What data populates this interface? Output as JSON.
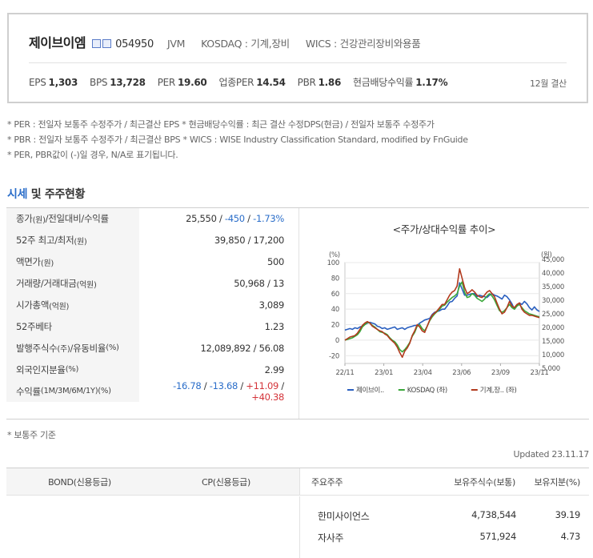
{
  "header": {
    "company_name": "제이브이엠",
    "code": "054950",
    "english_name": "JVM",
    "market": "KOSDAQ : 기계,장비",
    "wics": "WICS : 건강관리장비와용품",
    "ratios": [
      {
        "label": "EPS",
        "value": "1,303"
      },
      {
        "label": "BPS",
        "value": "13,728"
      },
      {
        "label": "PER",
        "value": "19.60"
      },
      {
        "label": "업종PER",
        "value": "14.54"
      },
      {
        "label": "PBR",
        "value": "1.86"
      },
      {
        "label": "현금배당수익률",
        "value": "1.17%"
      }
    ],
    "settlement": "12월 결산"
  },
  "notes": [
    "* PER : 전일자 보통주 수정주가 / 최근결산 EPS * 현금배당수익률 : 최근 결산 수정DPS(현금) / 전일자 보통주 수정주가",
    "* PBR : 전일자 보통주 수정주가 / 최근결산 BPS * WICS : WISE Industry Classification Standard, modified by FnGuide",
    "* PER, PBR값이 (-)일 경우, N/A로 표기됩니다."
  ],
  "section": {
    "title_accent": "시세",
    "title_rest": " 및 주주현황"
  },
  "price_table": {
    "rows": [
      {
        "label": "종가",
        "unit": "(원)",
        "label2": "/전일대비/수익률",
        "v1": "25,550",
        "sep1": " / ",
        "v2": "-450",
        "sep2": " / ",
        "v3": "-1.73%"
      },
      {
        "label": "52주 최고/최저",
        "unit": "(원)",
        "value": "39,850 / 17,200"
      },
      {
        "label": "액면가",
        "unit": "(원)",
        "value": "500"
      },
      {
        "label": "거래량/거래대금",
        "unit": "(억원)",
        "value": "50,968 / 13"
      },
      {
        "label": "시가총액",
        "unit": "(억원)",
        "value": "3,089"
      },
      {
        "label": "52주베타",
        "unit": "",
        "value": "1.23"
      },
      {
        "label": "발행주식수",
        "unit": "(주)",
        "label2": "/유동비율",
        "unit2": "(%)",
        "value": "12,089,892 / 56.08"
      },
      {
        "label": "외국인지분율",
        "unit": "(%)",
        "value": "2.99"
      },
      {
        "label": "수익률",
        "unit": "(1M/3M/6M/1Y)(%)",
        "r1": "-16.78",
        "r2": "-13.68",
        "r3": "+11.09",
        "r4": "+40.38",
        "sep": " / "
      }
    ]
  },
  "chart_data": {
    "type": "line",
    "title": "<주가/상대수익률 추이>",
    "ylabel_left": "(%)",
    "ylabel_right": "(원)",
    "x_ticks": [
      "22/11",
      "23/01",
      "23/04",
      "23/06",
      "23/09",
      "23/11"
    ],
    "y_left_ticks": [
      100,
      80,
      60,
      40,
      20,
      0,
      -20
    ],
    "y_right_ticks": [
      "45,000",
      "40,000",
      "35,000",
      "30,000",
      "25,000",
      "20,000",
      "15,000",
      "10,000",
      "5,000"
    ],
    "ylim_left": [
      -30,
      100
    ],
    "ylim_right": [
      5000,
      45000
    ],
    "grid": true,
    "legend_position": "bottom",
    "series": [
      {
        "name": "제이브이..",
        "color": "#2a5fbf",
        "axis": "left",
        "values": [
          13,
          14,
          15,
          14,
          16,
          15,
          17,
          18,
          20,
          22,
          23,
          22,
          21,
          18,
          17,
          15,
          16,
          14,
          15,
          16,
          17,
          14,
          15,
          16,
          14,
          16,
          17,
          18,
          19,
          19,
          22,
          24,
          26,
          27,
          28,
          33,
          36,
          37,
          38,
          40,
          40,
          44,
          49,
          50,
          54,
          57,
          74,
          66,
          58,
          58,
          59,
          60,
          60,
          56,
          58,
          57,
          56,
          55,
          58,
          60,
          58,
          57,
          55,
          53,
          58,
          56,
          52,
          47,
          40,
          44,
          48,
          46,
          50,
          47,
          42,
          39,
          43,
          39,
          37
        ]
      },
      {
        "name": "KOSDAQ (좌)",
        "color": "#3aa83a",
        "axis": "left",
        "values": [
          0,
          1,
          2,
          3,
          5,
          7,
          11,
          17,
          20,
          23,
          22,
          19,
          17,
          14,
          11,
          10,
          9,
          7,
          3,
          0,
          -2,
          -6,
          -12,
          -15,
          -12,
          -8,
          -3,
          5,
          10,
          18,
          20,
          15,
          12,
          18,
          25,
          30,
          34,
          37,
          40,
          44,
          45,
          49,
          52,
          55,
          57,
          60,
          70,
          75,
          62,
          55,
          56,
          60,
          58,
          54,
          52,
          50,
          53,
          57,
          60,
          57,
          52,
          45,
          38,
          36,
          38,
          42,
          46,
          42,
          40,
          44,
          46,
          42,
          38,
          36,
          34,
          33,
          32,
          31,
          30
        ]
      },
      {
        "name": "기계,장.. (좌)",
        "color": "#b23a1e",
        "axis": "left",
        "values": [
          0,
          2,
          4,
          5,
          6,
          9,
          14,
          19,
          22,
          24,
          22,
          18,
          16,
          14,
          12,
          11,
          8,
          6,
          2,
          -1,
          -4,
          -9,
          -16,
          -22,
          -14,
          -10,
          -4,
          6,
          12,
          20,
          17,
          12,
          10,
          18,
          26,
          32,
          35,
          38,
          42,
          46,
          46,
          52,
          58,
          62,
          64,
          70,
          92,
          80,
          68,
          60,
          62,
          65,
          62,
          58,
          56,
          55,
          58,
          62,
          64,
          60,
          56,
          48,
          40,
          34,
          36,
          42,
          50,
          44,
          42,
          46,
          48,
          40,
          36,
          34,
          32,
          32,
          31,
          30,
          29
        ]
      }
    ]
  },
  "footnote": "* 보통주 기준",
  "updated": "Updated 23.11.17",
  "bottom": {
    "headers": {
      "bond": "BOND(신용등급)",
      "cp": "CP(신용등급)",
      "holder": "주요주주",
      "shares": "보유주식수(보통)",
      "pct": "보유지분(%)"
    },
    "holders": [
      {
        "name": "한미사이언스",
        "shares": "4,738,544",
        "pct": "39.19"
      },
      {
        "name": "자사주",
        "shares": "571,924",
        "pct": "4.73"
      }
    ]
  }
}
